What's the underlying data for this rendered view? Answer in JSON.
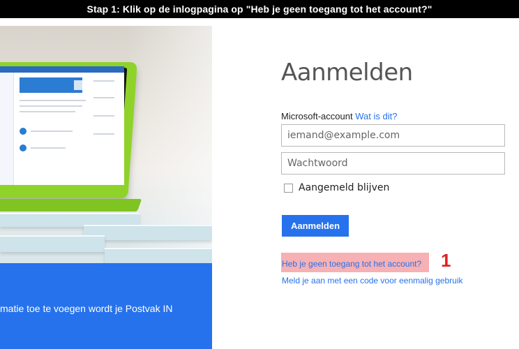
{
  "banner": {
    "text": "Stap 1: Klik op de inlogpagina op \"Heb je geen toegang tot het account?\""
  },
  "hero": {
    "caption": "matie toe te voegen wordt je Postvak IN"
  },
  "form": {
    "title": "Aanmelden",
    "account_label": "Microsoft-account",
    "what_is_this": "Wat is dit?",
    "email_placeholder": "iemand@example.com",
    "password_placeholder": "Wachtwoord",
    "remember_label": "Aangemeld blijven",
    "signin_button": "Aanmelden",
    "forgot_link": "Heb je geen toegang tot het account?",
    "code_link": "Meld je aan met een code voor eenmalig gebruik"
  },
  "annotation": {
    "number": "1",
    "highlight_color": "#f7b0b3",
    "number_color": "#e02020"
  },
  "colors": {
    "accent": "#2672ec",
    "banner_bg": "#000000"
  },
  "icons": {
    "checkbox": "checkbox-unchecked-icon"
  }
}
